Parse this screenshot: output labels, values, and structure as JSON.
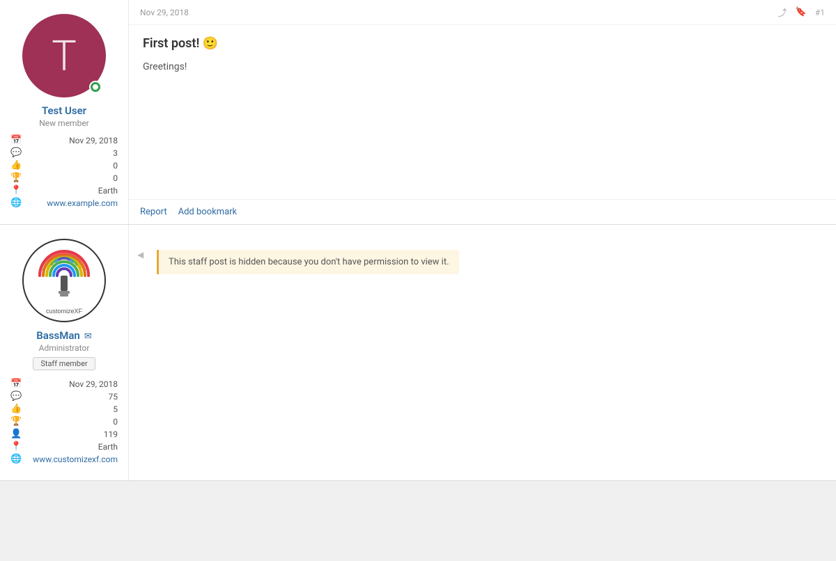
{
  "posts": [
    {
      "id": "post-1",
      "post_number": "#1",
      "timestamp": "Nov 29, 2018",
      "title": "First post! 🙂",
      "body": "Greetings!",
      "footer_links": [
        "Report",
        "Add bookmark"
      ],
      "author": {
        "username": "Test User",
        "title": "New member",
        "joined": "Nov 29, 2018",
        "messages": "3",
        "likes": "0",
        "trophies": "0",
        "location": "Earth",
        "website": "www.example.com",
        "avatar_letter": "T",
        "online": true,
        "is_staff": false
      }
    },
    {
      "id": "post-2",
      "post_number": "",
      "timestamp": "",
      "hidden": true,
      "hidden_message": "This staff post is hidden because you don't have permission to view it.",
      "author": {
        "username": "BassMan",
        "title": "Administrator",
        "staff_label": "Staff member",
        "joined": "Nov 29, 2018",
        "messages": "75",
        "likes": "5",
        "trophies": "0",
        "following": "119",
        "location": "Earth",
        "website": "www.customizexf.com",
        "online": false,
        "is_staff": true,
        "has_message_icon": true
      }
    }
  ],
  "icons": {
    "calendar": "📅",
    "messages": "💬",
    "likes": "👍",
    "trophies": "🏆",
    "following": "👤",
    "location": "📍",
    "website": "🌐",
    "share": "↗",
    "bookmark": "🔖"
  }
}
